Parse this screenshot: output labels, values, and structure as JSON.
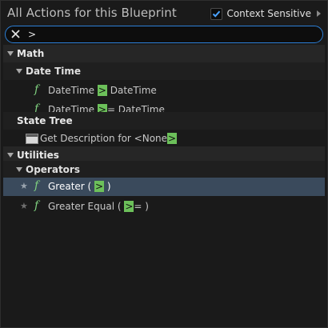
{
  "header": {
    "title": "All Actions for this Blueprint",
    "context_sensitive_label": "Context Sensitive",
    "context_sensitive_checked": true
  },
  "search": {
    "value": ">"
  },
  "tree": {
    "math": {
      "label": "Math",
      "date_time": {
        "label": "Date Time",
        "items": [
          {
            "before": "DateTime ",
            "match": ">",
            "after": " DateTime"
          },
          {
            "before": "DateTime ",
            "match": ">",
            "after": "= DateTime"
          }
        ]
      }
    },
    "state_tree": {
      "label": "State Tree",
      "items": [
        {
          "before": "Get Description for <None",
          "match": ">",
          "after": ""
        }
      ]
    },
    "utilities": {
      "label": "Utilities",
      "operators": {
        "label": "Operators",
        "items": [
          {
            "before": "Greater ( ",
            "match": ">",
            "after": " )"
          },
          {
            "before": "Greater Equal ( ",
            "match": ">",
            "after": "= )"
          }
        ]
      }
    }
  },
  "colors": {
    "accent": "#2c7fd6",
    "match_highlight": "#6cc05a",
    "function_icon": "#7fd07f",
    "selection": "#3a4a5c"
  }
}
